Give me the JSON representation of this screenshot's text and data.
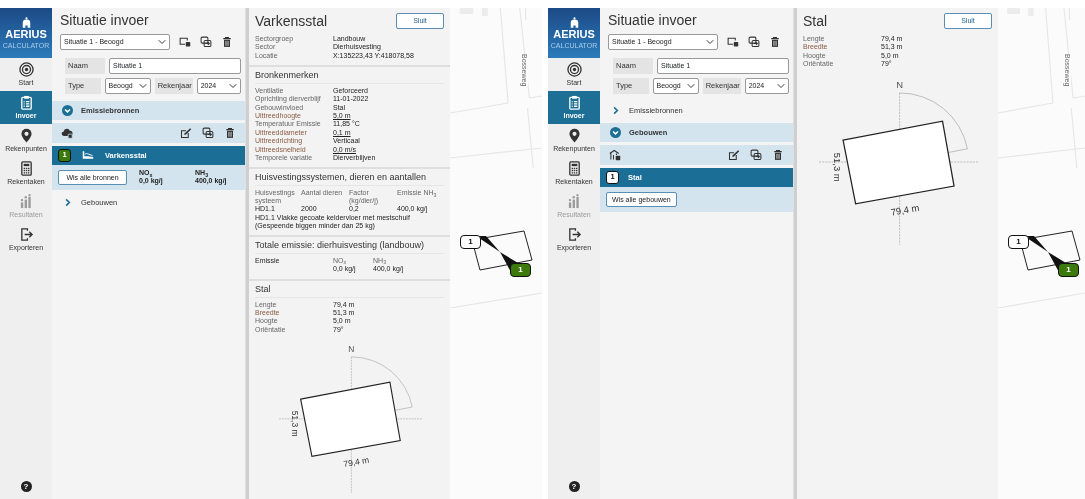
{
  "screens": [
    {
      "nav": {
        "logo_title": "AERIUS",
        "logo_subtitle": "CALCULATOR",
        "items": [
          {
            "kind": "start",
            "label": "Start",
            "selected": false,
            "disabled": false
          },
          {
            "kind": "input",
            "label": "Invoer",
            "selected": true,
            "disabled": false
          },
          {
            "kind": "points",
            "label": "Rekenpunten",
            "selected": false,
            "disabled": false
          },
          {
            "kind": "jobs",
            "label": "Rekentaken",
            "selected": false,
            "disabled": false
          },
          {
            "kind": "results",
            "label": "Resultaten",
            "selected": false,
            "disabled": true
          },
          {
            "kind": "export",
            "label": "Exporteren",
            "selected": false,
            "disabled": false
          }
        ],
        "help": "?"
      },
      "panel": {
        "title": "Situatie invoer",
        "situation": "Situatie 1 - Beoogd",
        "name": {
          "label": "Naam",
          "value": "Situatie 1"
        },
        "type": {
          "label": "Type",
          "value": "Beoogd"
        },
        "year": {
          "label": "Rekenjaar",
          "value": "2024"
        },
        "sections": [
          {
            "kind": "sources",
            "label": "Emissiebronnen",
            "expanded": true,
            "items": [
              {
                "number": "1",
                "label": "Varkensstal",
                "selected": true,
                "color": "#3d7a0d"
              }
            ],
            "clear_button": "Wis alle bronnen",
            "totals": [
              {
                "label": "NO$_{x}$",
                "value": "0,0 kg/j"
              },
              {
                "label": "NH$_{3}$",
                "value": "400,0 kg/j"
              }
            ]
          },
          {
            "kind": "buildings",
            "label": "Gebouwen",
            "expanded": false
          }
        ]
      },
      "detail": {
        "title": "Varkensstal",
        "close": "Sluit",
        "sections": [
          {
            "kind": "props",
            "rows": [
              {
                "label": "Sectorgroep",
                "value": "Landbouw",
                "accent": false,
                "underlined": false
              },
              {
                "label": "Sector",
                "value": "Dierhuisvesting",
                "accent": false,
                "underlined": false
              },
              {
                "label": "Locatie",
                "value": "X:135223,43 Y:418078,58",
                "accent": false,
                "underlined": false
              }
            ]
          },
          {
            "kind": "props",
            "heading": "Bronkenmerken",
            "rows": [
              {
                "label": "Ventilatie",
                "value": "Geforceerd",
                "accent": false,
                "underlined": false
              },
              {
                "label": "Oprichting dierverblijf",
                "value": "11-01-2022",
                "accent": false,
                "underlined": false
              },
              {
                "label": "Gebouwinvloed",
                "value": "Stal",
                "accent": false,
                "underlined": false
              },
              {
                "label": "Uittreedhoogte",
                "value": "5,0 m",
                "accent": true,
                "underlined": true
              },
              {
                "label": "Temperatuur Emissie",
                "value": "11,85 °C",
                "accent": false,
                "underlined": false
              },
              {
                "label": "Uittreeddiameter",
                "value": "0,1 m",
                "accent": true,
                "underlined": true
              },
              {
                "label": "Uittreedrichting",
                "value": "Verticaal",
                "accent": true,
                "underlined": false
              },
              {
                "label": "Uittreedsnelheid",
                "value": "0,0 m/s",
                "accent": true,
                "underlined": true
              },
              {
                "label": "Temporele variatie",
                "value": "Dierverblijven",
                "accent": false,
                "underlined": false
              }
            ]
          },
          {
            "kind": "table",
            "heading": "Huisvestingssystemen, dieren en aantallen",
            "columns": [
              "Huisvestings systeem",
              "Aantal dieren",
              "Factor (kg/dier/j)",
              "Emissie NH$_{3}$"
            ],
            "rows": [
              [
                "HD1.1",
                "2000",
                "0,2",
                "400,0 kg/j"
              ]
            ],
            "note": "HD1.1 Vlakke gecoate keldervloer met mestschuif (Gespeende biggen minder dan 25 kg)"
          },
          {
            "kind": "emission",
            "heading": "Totale emissie: dierhuisvesting (landbouw)",
            "label": "Emissie",
            "values": [
              {
                "label": "NO$_{x}$",
                "value": "0,0 kg/j"
              },
              {
                "label": "NH$_{3}$",
                "value": "400,0 kg/j"
              }
            ]
          },
          {
            "kind": "props",
            "heading": "Stal",
            "rows": [
              {
                "label": "Lengte",
                "value": "79,4 m",
                "accent": false,
                "underlined": false
              },
              {
                "label": "Breedte",
                "value": "51,3 m",
                "accent": true,
                "underlined": false
              },
              {
                "label": "Hoogte",
                "value": "5,0 m",
                "accent": false,
                "underlined": false
              },
              {
                "label": "Oriëntatie",
                "value": "79°",
                "accent": false,
                "underlined": false
              }
            ]
          },
          {
            "kind": "diagram",
            "north": "N",
            "length_label": "79,4 m",
            "width_label": "51,3 m"
          }
        ]
      },
      "map": {
        "street": "Bosseweg",
        "markers": [
          {
            "label": "1",
            "color": "#ffffff"
          },
          {
            "label": "1",
            "color": "#3d7a0d"
          }
        ]
      }
    },
    {
      "nav": {
        "logo_title": "AERIUS",
        "logo_subtitle": "CALCULATOR",
        "items": [
          {
            "kind": "start",
            "label": "Start",
            "selected": false,
            "disabled": false
          },
          {
            "kind": "input",
            "label": "Invoer",
            "selected": true,
            "disabled": false
          },
          {
            "kind": "points",
            "label": "Rekenpunten",
            "selected": false,
            "disabled": false
          },
          {
            "kind": "jobs",
            "label": "Rekentaken",
            "selected": false,
            "disabled": false
          },
          {
            "kind": "results",
            "label": "Resultaten",
            "selected": false,
            "disabled": true
          },
          {
            "kind": "export",
            "label": "Exporteren",
            "selected": false,
            "disabled": false
          }
        ],
        "help": "?"
      },
      "panel": {
        "title": "Situatie invoer",
        "situation": "Situatie 1 - Beoogd",
        "name": {
          "label": "Naam",
          "value": "Situatie 1"
        },
        "type": {
          "label": "Type",
          "value": "Beoogd"
        },
        "year": {
          "label": "Rekenjaar",
          "value": "2024"
        },
        "sections": [
          {
            "kind": "sources",
            "label": "Emissiebronnen",
            "expanded": false
          },
          {
            "kind": "buildings",
            "label": "Gebouwen",
            "expanded": true,
            "items": [
              {
                "number": "1",
                "label": "Stal",
                "selected": true,
                "color": "#ffffff"
              }
            ],
            "clear_button": "Wis alle gebouwen"
          }
        ]
      },
      "detail": {
        "title": "Stal",
        "close": "Sluit",
        "sections": [
          {
            "kind": "props",
            "rows": [
              {
                "label": "Lengte",
                "value": "79,4 m",
                "accent": false,
                "underlined": false
              },
              {
                "label": "Breedte",
                "value": "51,3 m",
                "accent": true,
                "underlined": false
              },
              {
                "label": "Hoogte",
                "value": "5,0 m",
                "accent": false,
                "underlined": false
              },
              {
                "label": "Oriëntatie",
                "value": "79°",
                "accent": false,
                "underlined": false
              }
            ]
          },
          {
            "kind": "diagram",
            "north": "N",
            "length_label": "79,4 m",
            "width_label": "51,3 m"
          }
        ]
      },
      "map": {
        "street": "Bosseweg",
        "markers": [
          {
            "label": "1",
            "color": "#ffffff"
          },
          {
            "label": "1",
            "color": "#3d7a0d"
          }
        ]
      }
    }
  ]
}
